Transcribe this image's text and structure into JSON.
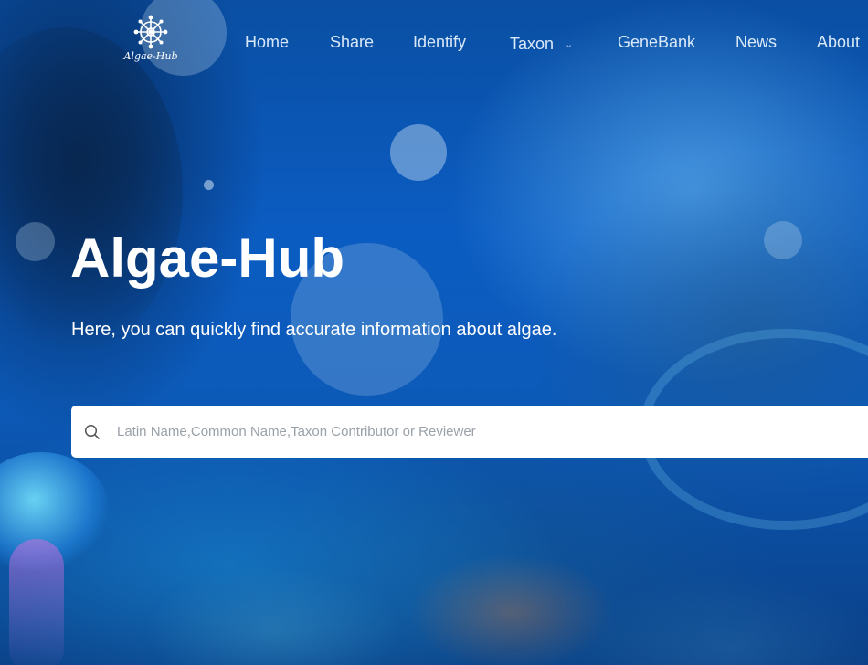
{
  "brand": {
    "logo_text": "Algae-Hub",
    "logo_icon": "diatom-logo-icon"
  },
  "nav": {
    "items": [
      {
        "label": "Home"
      },
      {
        "label": "Share"
      },
      {
        "label": "Identify"
      },
      {
        "label": "Taxon",
        "has_dropdown": true,
        "dropdown_icon": "chevron-down-icon"
      },
      {
        "label": "GeneBank"
      },
      {
        "label": "News"
      },
      {
        "label": "About"
      }
    ]
  },
  "hero": {
    "title": "Algae-Hub",
    "subtitle": "Here, you can quickly find accurate information about algae."
  },
  "search": {
    "icon": "search-icon",
    "value": "",
    "placeholder": "Latin Name,Common Name,Taxon Contributor or Reviewer"
  },
  "colors": {
    "background": "#0b5cc2",
    "nav_text": "#ebf5ff",
    "hero_text": "#ffffff",
    "search_bg": "#ffffff",
    "placeholder": "#9aa1a8"
  }
}
